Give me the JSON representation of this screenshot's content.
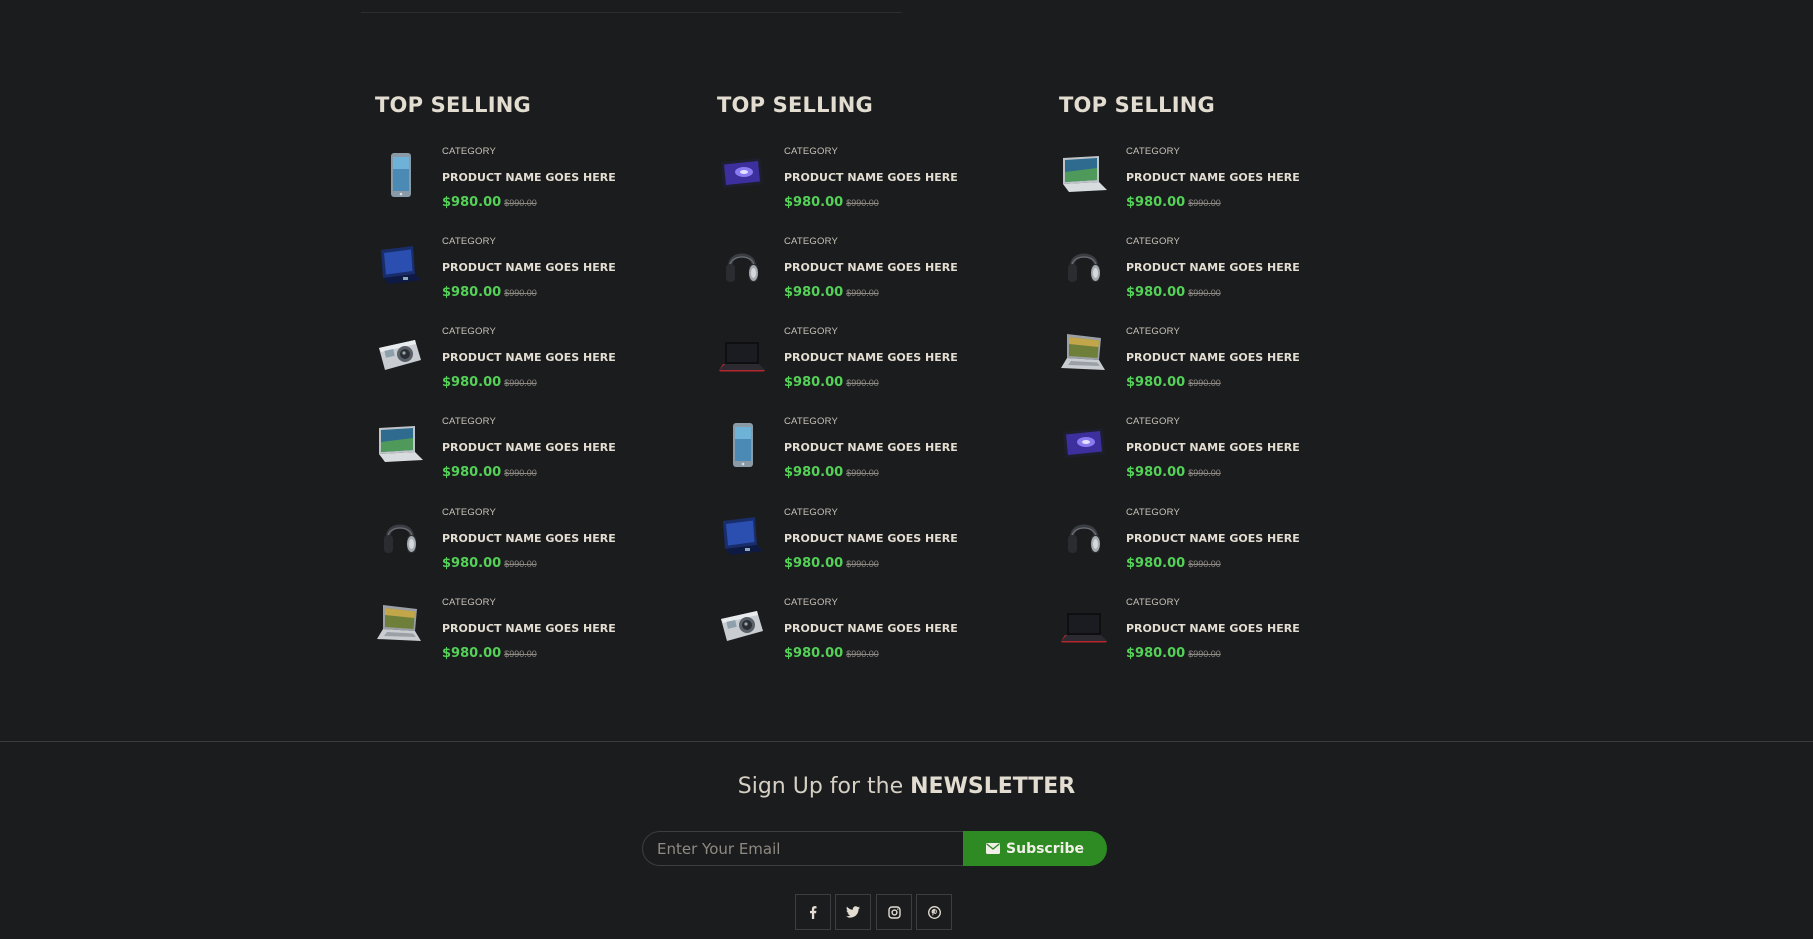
{
  "columns": [
    {
      "title": "TOP SELLING",
      "products": [
        {
          "category": "CATEGORY",
          "name": "PRODUCT NAME GOES HERE",
          "price": "$980.00",
          "old_price": "$990.00",
          "image": "smartphone"
        },
        {
          "category": "CATEGORY",
          "name": "PRODUCT NAME GOES HERE",
          "price": "$980.00",
          "old_price": "$990.00",
          "image": "laptop-dark"
        },
        {
          "category": "CATEGORY",
          "name": "PRODUCT NAME GOES HERE",
          "price": "$980.00",
          "old_price": "$990.00",
          "image": "camera"
        },
        {
          "category": "CATEGORY",
          "name": "PRODUCT NAME GOES HERE",
          "price": "$980.00",
          "old_price": "$990.00",
          "image": "laptop-silver"
        },
        {
          "category": "CATEGORY",
          "name": "PRODUCT NAME GOES HERE",
          "price": "$980.00",
          "old_price": "$990.00",
          "image": "headphones"
        },
        {
          "category": "CATEGORY",
          "name": "PRODUCT NAME GOES HERE",
          "price": "$980.00",
          "old_price": "$990.00",
          "image": "laptop-open"
        }
      ]
    },
    {
      "title": "TOP SELLING",
      "products": [
        {
          "category": "CATEGORY",
          "name": "PRODUCT NAME GOES HERE",
          "price": "$980.00",
          "old_price": "$990.00",
          "image": "tablet"
        },
        {
          "category": "CATEGORY",
          "name": "PRODUCT NAME GOES HERE",
          "price": "$980.00",
          "old_price": "$990.00",
          "image": "headphones"
        },
        {
          "category": "CATEGORY",
          "name": "PRODUCT NAME GOES HERE",
          "price": "$980.00",
          "old_price": "$990.00",
          "image": "laptop-red"
        },
        {
          "category": "CATEGORY",
          "name": "PRODUCT NAME GOES HERE",
          "price": "$980.00",
          "old_price": "$990.00",
          "image": "smartphone"
        },
        {
          "category": "CATEGORY",
          "name": "PRODUCT NAME GOES HERE",
          "price": "$980.00",
          "old_price": "$990.00",
          "image": "laptop-dark"
        },
        {
          "category": "CATEGORY",
          "name": "PRODUCT NAME GOES HERE",
          "price": "$980.00",
          "old_price": "$990.00",
          "image": "camera"
        }
      ]
    },
    {
      "title": "TOP SELLING",
      "products": [
        {
          "category": "CATEGORY",
          "name": "PRODUCT NAME GOES HERE",
          "price": "$980.00",
          "old_price": "$990.00",
          "image": "laptop-silver"
        },
        {
          "category": "CATEGORY",
          "name": "PRODUCT NAME GOES HERE",
          "price": "$980.00",
          "old_price": "$990.00",
          "image": "headphones"
        },
        {
          "category": "CATEGORY",
          "name": "PRODUCT NAME GOES HERE",
          "price": "$980.00",
          "old_price": "$990.00",
          "image": "laptop-open"
        },
        {
          "category": "CATEGORY",
          "name": "PRODUCT NAME GOES HERE",
          "price": "$980.00",
          "old_price": "$990.00",
          "image": "tablet"
        },
        {
          "category": "CATEGORY",
          "name": "PRODUCT NAME GOES HERE",
          "price": "$980.00",
          "old_price": "$990.00",
          "image": "headphones"
        },
        {
          "category": "CATEGORY",
          "name": "PRODUCT NAME GOES HERE",
          "price": "$980.00",
          "old_price": "$990.00",
          "image": "laptop-red"
        }
      ]
    }
  ],
  "newsletter": {
    "title_prefix": "Sign Up for the",
    "title_bold": "NEWSLETTER",
    "email_placeholder": "Enter Your Email",
    "subscribe_label": "Subscribe",
    "subscribe_icon": "envelope-icon"
  },
  "social": [
    {
      "name": "facebook-icon",
      "glyph": "f"
    },
    {
      "name": "twitter-icon",
      "glyph": "twitter"
    },
    {
      "name": "instagram-icon",
      "glyph": "instagram"
    },
    {
      "name": "pinterest-icon",
      "glyph": "pinterest"
    }
  ],
  "colors": {
    "background": "#1b1c1e",
    "price_green": "#54d157",
    "button_green": "#2e8b23",
    "title_text": "#e3ddd1"
  }
}
